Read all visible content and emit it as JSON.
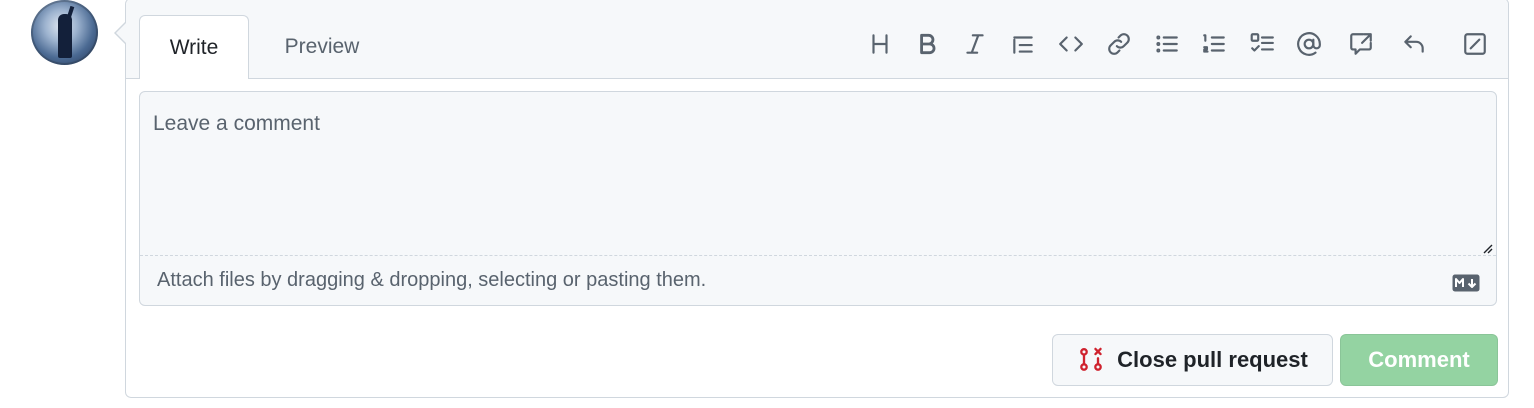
{
  "tabs": {
    "write": "Write",
    "preview": "Preview"
  },
  "toolbar": [
    "heading-icon",
    "bold-icon",
    "italic-icon",
    "quote-icon",
    "code-icon",
    "link-icon",
    "unordered-list-icon",
    "ordered-list-icon",
    "task-list-icon",
    "mention-icon",
    "cross-reference-icon",
    "saved-reply-icon",
    "fullscreen-icon"
  ],
  "editor": {
    "placeholder": "Leave a comment",
    "value": "",
    "attach_hint": "Attach files by dragging & dropping, selecting or pasting them."
  },
  "actions": {
    "close_label": "Close pull request",
    "comment_label": "Comment"
  },
  "colors": {
    "close_icon": "#cf222e",
    "comment_disabled": "#94d3a2",
    "border": "#d0d7de",
    "muted_text": "#59636e"
  }
}
